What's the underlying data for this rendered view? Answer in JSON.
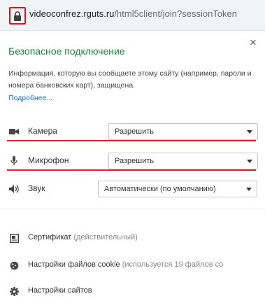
{
  "addressbar": {
    "url_host": "videoconfrez.rguts.ru",
    "url_path": "/html5client/join?sessionToken"
  },
  "popup": {
    "title": "Безопасное подключение",
    "info_text": "Информация, которую вы сообщаете этому сайту (например, пароли и номера банковских карт), защищена.",
    "more_link": "Подробнее...",
    "close_icon": "×"
  },
  "permissions": [
    {
      "label": "Камера",
      "value": "Разрешить",
      "icon": "camera-icon"
    },
    {
      "label": "Микрофон",
      "value": "Разрешить",
      "icon": "microphone-icon"
    },
    {
      "label": "Звук",
      "value": "Автоматически (по умолчанию)",
      "icon": "speaker-icon"
    }
  ],
  "footer": {
    "certificate": {
      "label": "Сертификат",
      "status": "(действительный)"
    },
    "cookies": {
      "label": "Настройки файлов cookie",
      "status": "(используется 19 файлов co"
    },
    "site_settings": {
      "label": "Настройки сайтов"
    }
  },
  "colors": {
    "accent_green": "#1a8a3a",
    "highlight_red": "#e0202a",
    "link_blue": "#1a73e8"
  }
}
